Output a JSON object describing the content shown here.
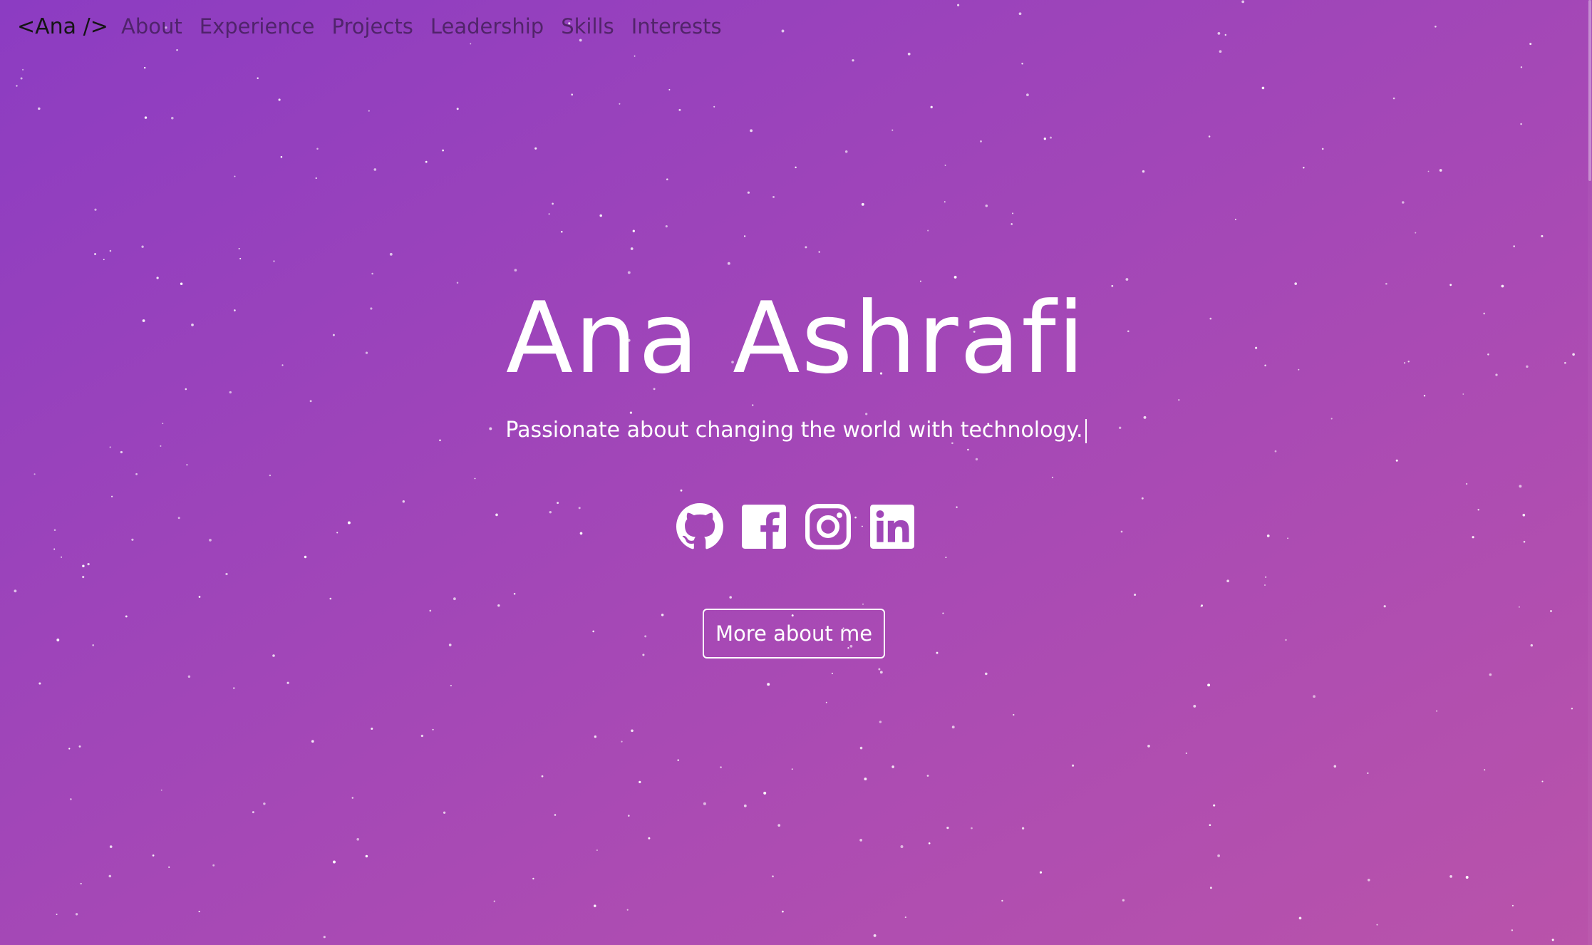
{
  "nav": {
    "brand": "<Ana />",
    "links": [
      {
        "label": "About"
      },
      {
        "label": "Experience"
      },
      {
        "label": "Projects"
      },
      {
        "label": "Leadership"
      },
      {
        "label": "Skills"
      },
      {
        "label": "Interests"
      }
    ]
  },
  "hero": {
    "name": "Ana Ashrafi",
    "tagline": "Passionate about changing the world with technology.",
    "cta_label": "More about me"
  },
  "socials": [
    {
      "icon": "github-icon"
    },
    {
      "icon": "facebook-icon"
    },
    {
      "icon": "instagram-icon"
    },
    {
      "icon": "linkedin-icon"
    }
  ],
  "colors": {
    "gradient_start": "#8c3cc2",
    "gradient_end": "#b953aa",
    "text": "#ffffff",
    "brand_text": "#151515"
  }
}
